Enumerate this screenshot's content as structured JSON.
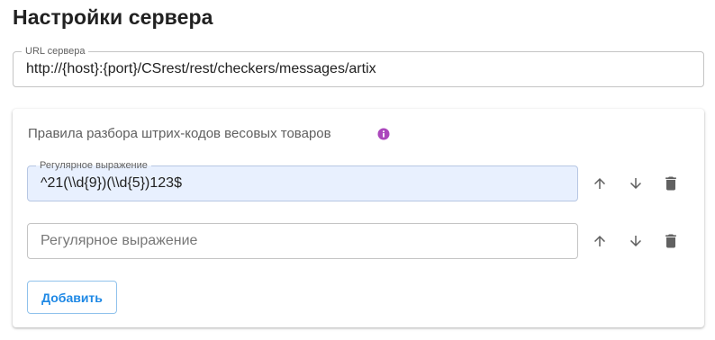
{
  "page": {
    "title": "Настройки сервера"
  },
  "url_field": {
    "label": "URL сервера",
    "value": "http://{host}:{port}/CSrest/rest/checkers/messages/artix"
  },
  "barcode_rules": {
    "title": "Правила разбора штрих-кодов весовых товаров",
    "info_icon": "info-icon",
    "rules": [
      {
        "label": "Регулярное выражение",
        "value": "^21(\\\\d{9})(\\\\d{5})123$",
        "placeholder": ""
      },
      {
        "label": "",
        "value": "",
        "placeholder": "Регулярное выражение"
      }
    ],
    "row_actions": [
      "arrow-up-icon",
      "arrow-down-icon",
      "trash-icon"
    ],
    "add_button_label": "Добавить"
  },
  "colors": {
    "icon_gray": "#616161",
    "info_purple": "#ab47bc",
    "autofill_bg": "#e8f0fe",
    "accent_blue": "#1e88e5"
  }
}
